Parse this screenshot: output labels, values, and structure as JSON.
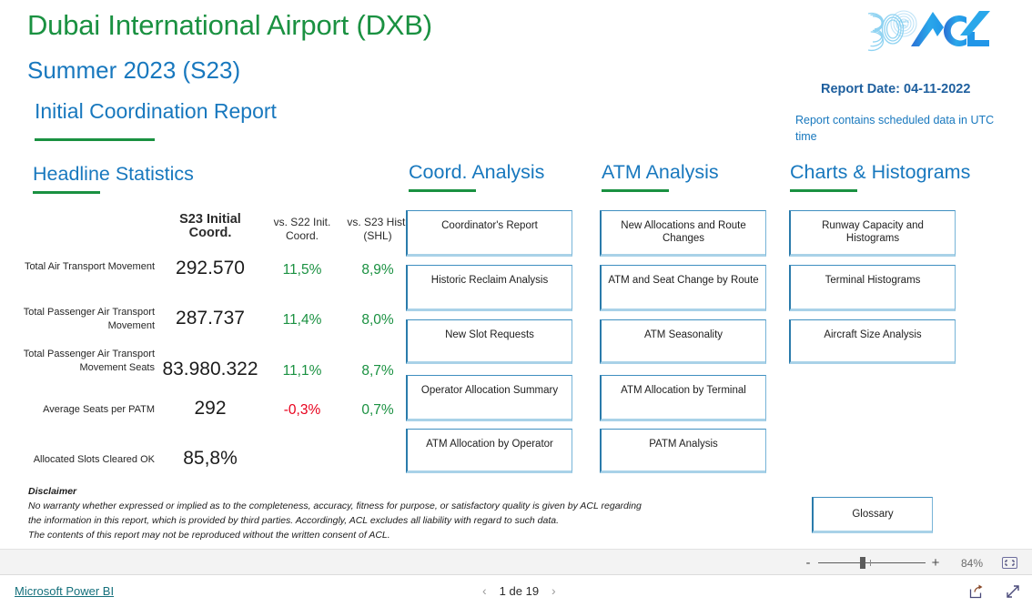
{
  "header": {
    "airport_title": "Dubai International Airport (DXB)",
    "season_title": "Summer 2023 (S23)",
    "report_title": "Initial Coordination Report",
    "logo_name": "acl-30-years-logo",
    "report_date": "Report Date: 04-11-2022",
    "report_note": "Report contains scheduled data in UTC time",
    "colors": {
      "green": "#1a9141",
      "blue": "#1878be",
      "dark_blue": "#1e5f9e",
      "red": "#e8001c"
    }
  },
  "sections": {
    "headline": {
      "title": "Headline Statistics"
    },
    "coord": {
      "title": "Coord. Analysis"
    },
    "atm": {
      "title": "ATM Analysis"
    },
    "charts": {
      "title": "Charts & Histograms"
    }
  },
  "stats_table": {
    "columns": [
      "",
      "S23 Initial Coord.",
      "vs. S22 Init. Coord.",
      "vs. S23 Hist. (SHL)"
    ],
    "column_headers": {
      "main": "S23 Initial Coord.",
      "c2_line1": "vs. S22 Init.",
      "c2_line2": "Coord.",
      "c3_line1": "vs. S23 Hist.",
      "c3_line2": "(SHL)"
    },
    "rows": [
      {
        "label": "Total Air Transport Movement",
        "value": "292.570",
        "vs_s22": "11,5%",
        "vs_s22_sign": "positive",
        "vs_shl": "8,9%",
        "vs_shl_sign": "positive"
      },
      {
        "label": "Total Passenger Air Transport Movement",
        "value": "287.737",
        "vs_s22": "11,4%",
        "vs_s22_sign": "positive",
        "vs_shl": "8,0%",
        "vs_shl_sign": "positive"
      },
      {
        "label": "Total Passenger Air Transport Movement Seats",
        "value": "83.980.322",
        "vs_s22": "11,1%",
        "vs_s22_sign": "positive",
        "vs_shl": "8,7%",
        "vs_shl_sign": "positive"
      },
      {
        "label": "Average Seats per PATM",
        "value": "292",
        "vs_s22": "-0,3%",
        "vs_s22_sign": "negative",
        "vs_shl": "0,7%",
        "vs_shl_sign": "positive"
      },
      {
        "label": "Allocated Slots Cleared OK",
        "value": "85,8%",
        "vs_s22": "",
        "vs_s22_sign": "none",
        "vs_shl": "",
        "vs_shl_sign": "none"
      }
    ]
  },
  "coord_buttons": [
    "Coordinator's Report",
    "Historic Reclaim Analysis",
    "New Slot Requests",
    "Operator Allocation Summary",
    "ATM Allocation by Operator"
  ],
  "atm_buttons": [
    "New Allocations and Route Changes",
    "ATM and Seat Change by Route",
    "ATM Seasonality",
    "ATM Allocation by Terminal",
    "PATM Analysis"
  ],
  "charts_buttons": [
    "Runway Capacity and Histograms",
    "Terminal Histograms",
    "Aircraft Size Analysis"
  ],
  "glossary_button": "Glossary",
  "disclaimer": {
    "title": "Disclaimer",
    "line1": "No warranty whether expressed or implied as to the completeness, accuracy, fitness for purpose, or satisfactory quality is given by ACL regarding",
    "line2": "the information in this report, which is provided by third parties. Accordingly, ACL excludes all liability with regard to such data.",
    "line3": "The contents of this report may not be reproduced without the written consent of ACL."
  },
  "statusbar": {
    "zoom_out_label": "-",
    "zoom_in_label": "+",
    "zoom_level": "84%",
    "fit_icon": "fit-to-page-icon"
  },
  "footer": {
    "powerbi_link": "Microsoft Power BI",
    "prev_arrow": "‹",
    "page_label": "1 de 19",
    "next_arrow": "›",
    "share_icon": "share-icon",
    "fullscreen_icon": "fullscreen-icon"
  }
}
